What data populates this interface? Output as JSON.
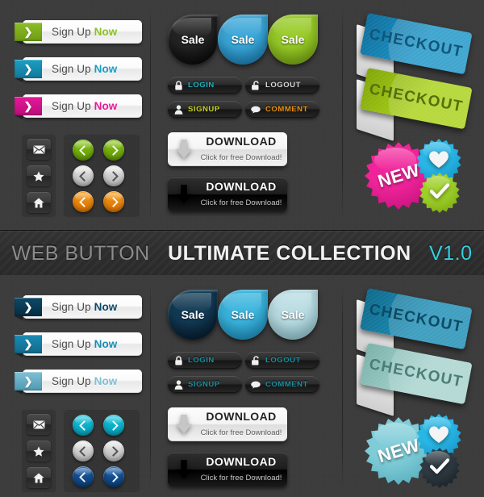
{
  "banner": {
    "part1": "WEB BUTTON",
    "part2": "ULTIMATE COLLECTION",
    "part3": "V1.0",
    "color1": "#8d8d8d",
    "color2": "#f2f2f2",
    "color3": "#34cfe0"
  },
  "background": "#3c3c3c",
  "sections": [
    {
      "id": "top",
      "theme": "multicolor",
      "signup_buttons": [
        {
          "label_normal": "Sign Up ",
          "label_bold": "Now",
          "accent": "#8cbf26",
          "accent_dark": "#6f9a14"
        },
        {
          "label_normal": "Sign Up ",
          "label_bold": "Now",
          "accent": "#1b9ec4",
          "accent_dark": "#12789a"
        },
        {
          "label_normal": "Sign Up ",
          "label_bold": "Now",
          "accent": "#e8189b",
          "accent_dark": "#b80d78"
        }
      ],
      "tiles": [
        {
          "icon": "mail-icon"
        },
        {
          "icon": "star-icon"
        },
        {
          "icon": "home-icon"
        }
      ],
      "arrows": [
        {
          "dir": "left",
          "accent": "#86c715",
          "accent_dark": "#5f9504",
          "style": "light"
        },
        {
          "dir": "right",
          "accent": "#86c715",
          "accent_dark": "#5f9504",
          "style": "light"
        },
        {
          "dir": "left",
          "accent": "#e8e8e8",
          "accent_dark": "#b4b4b4",
          "style": "dark"
        },
        {
          "dir": "right",
          "accent": "#e8e8e8",
          "accent_dark": "#b4b4b4",
          "style": "dark"
        },
        {
          "dir": "left",
          "accent": "#f79b18",
          "accent_dark": "#d46f02",
          "style": "light"
        },
        {
          "dir": "right",
          "accent": "#f79b18",
          "accent_dark": "#d46f02",
          "style": "light"
        }
      ],
      "sale_buttons": [
        {
          "label": "Sale",
          "accent": "#232323",
          "accent_dark": "#000000"
        },
        {
          "label": "Sale",
          "accent": "#3aa6d8",
          "accent_dark": "#1273a8"
        },
        {
          "label": "Sale",
          "accent": "#97ca27",
          "accent_dark": "#6e9b0d"
        }
      ],
      "pills": [
        {
          "label": "LOGIN",
          "icon": "lock-closed-icon",
          "color": "#17b6c4"
        },
        {
          "label": "LOGOUT",
          "icon": "lock-open-icon",
          "color": "#d8d8d8"
        },
        {
          "label": "SIGNUP",
          "icon": "user-icon",
          "color": "#c8d62a"
        },
        {
          "label": "COMMENT",
          "icon": "comment-icon",
          "color": "#e8920f"
        }
      ],
      "download_buttons": [
        {
          "title": "DOWNLOAD",
          "subtitle": "Click for free Download!",
          "style": "light"
        },
        {
          "title": "DOWNLOAD",
          "subtitle": "Click for free Download!",
          "style": "dark"
        }
      ],
      "ribbons": [
        {
          "label": "CHECKOUT",
          "accent": "#1b94c6",
          "accent_dark": "#0f6e9c",
          "text_color": "#10567a"
        },
        {
          "label": "CHECKOUT",
          "accent": "#a9d117",
          "accent_dark": "#81a709",
          "text_color": "#55700a"
        }
      ],
      "badges": [
        {
          "type": "new",
          "label": "NEW",
          "accent": "#f0249a",
          "accent_dark": "#b80c73"
        },
        {
          "type": "heart",
          "icon": "heart-icon",
          "accent": "#29b6e5",
          "accent_dark": "#0f85b8"
        },
        {
          "type": "check",
          "icon": "check-icon",
          "accent": "#9fd02a",
          "accent_dark": "#6f9c0b"
        }
      ]
    },
    {
      "id": "bottom",
      "theme": "blue",
      "signup_buttons": [
        {
          "label_normal": "Sign Up ",
          "label_bold": "Now",
          "accent": "#0d4a68",
          "accent_dark": "#062c42"
        },
        {
          "label_normal": "Sign Up ",
          "label_bold": "Now",
          "accent": "#1b8cb4",
          "accent_dark": "#11698c"
        },
        {
          "label_normal": "Sign Up ",
          "label_bold": "Now",
          "accent": "#7fc0d4",
          "accent_dark": "#4e9ab4"
        }
      ],
      "tiles": [
        {
          "icon": "mail-icon"
        },
        {
          "icon": "star-icon"
        },
        {
          "icon": "home-icon"
        }
      ],
      "arrows": [
        {
          "dir": "left",
          "accent": "#18c6de",
          "accent_dark": "#039ab4",
          "style": "light"
        },
        {
          "dir": "right",
          "accent": "#18c6de",
          "accent_dark": "#039ab4",
          "style": "light"
        },
        {
          "dir": "left",
          "accent": "#e8e8e8",
          "accent_dark": "#b4b4b4",
          "style": "dark"
        },
        {
          "dir": "right",
          "accent": "#e8e8e8",
          "accent_dark": "#b4b4b4",
          "style": "dark"
        },
        {
          "dir": "left",
          "accent": "#1a5fa8",
          "accent_dark": "#0c3b72",
          "style": "light"
        },
        {
          "dir": "right",
          "accent": "#1a5fa8",
          "accent_dark": "#0c3b72",
          "style": "light"
        }
      ],
      "sale_buttons": [
        {
          "label": "Sale",
          "accent": "#123a54",
          "accent_dark": "#02101e"
        },
        {
          "label": "Sale",
          "accent": "#3ab4dd",
          "accent_dark": "#1684b4"
        },
        {
          "label": "Sale",
          "accent": "#b8dce2",
          "accent_dark": "#86bcc8"
        }
      ],
      "pills": [
        {
          "label": "LOGIN",
          "icon": "lock-closed-icon",
          "color": "#1d8f9e"
        },
        {
          "label": "LOGOUT",
          "icon": "lock-open-icon",
          "color": "#1d8f9e"
        },
        {
          "label": "SIGNUP",
          "icon": "user-icon",
          "color": "#1d8f9e"
        },
        {
          "label": "COMMENT",
          "icon": "comment-icon",
          "color": "#1d8f9e"
        }
      ],
      "download_buttons": [
        {
          "title": "DOWNLOAD",
          "subtitle": "Click for free Download!",
          "style": "light"
        },
        {
          "title": "DOWNLOAD",
          "subtitle": "Click for free Download!",
          "style": "dark"
        }
      ],
      "ribbons": [
        {
          "label": "CHECKOUT",
          "accent": "#1b8cb4",
          "accent_dark": "#0f6a8c",
          "text_color": "#0d4a66"
        },
        {
          "label": "CHECKOUT",
          "accent": "#a6d2cc",
          "accent_dark": "#79b2ab",
          "text_color": "#4a7d76"
        }
      ],
      "badges": [
        {
          "type": "new",
          "label": "NEW",
          "accent": "#7fccd8",
          "accent_dark": "#4ba3b4"
        },
        {
          "type": "heart",
          "icon": "heart-icon",
          "accent": "#29b6e5",
          "accent_dark": "#0f85b8"
        },
        {
          "type": "check",
          "icon": "check-icon",
          "accent": "#2e3a42",
          "accent_dark": "#10171c"
        }
      ]
    }
  ]
}
